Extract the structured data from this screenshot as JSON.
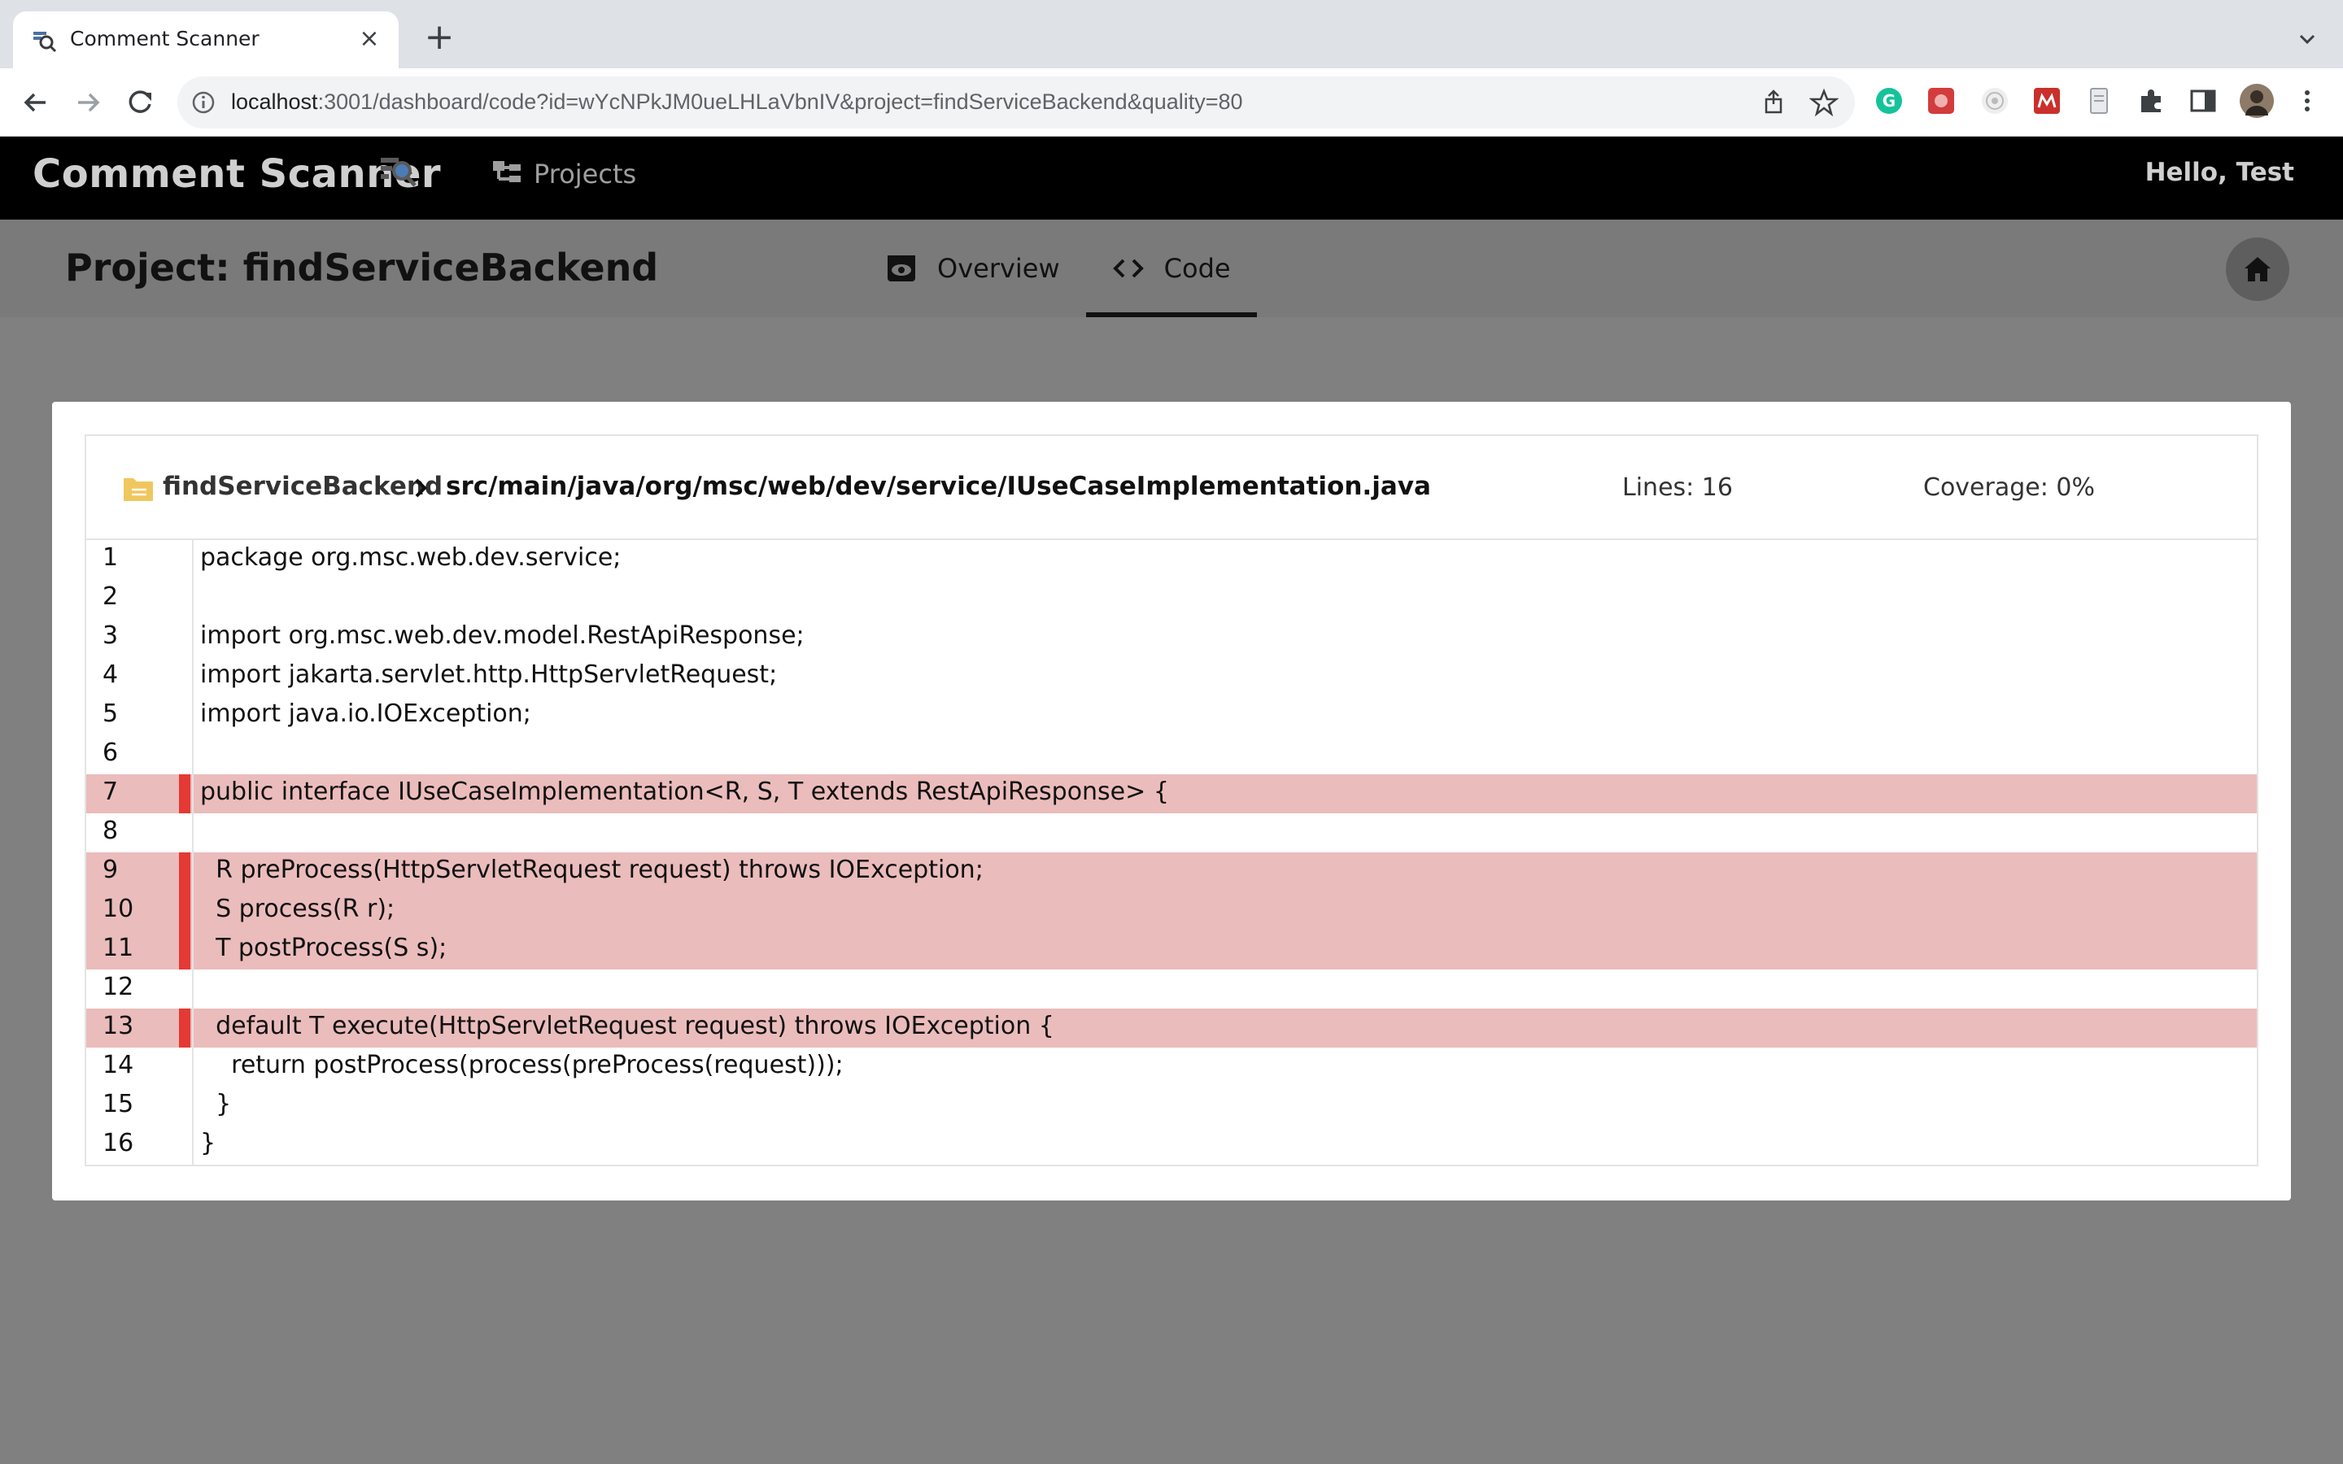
{
  "browser": {
    "tab_title": "Comment Scanner",
    "url_host": "localhost",
    "url_path": ":3001/dashboard/code?id=wYcNPkJM0ueLHLaVbnIV&project=findServiceBackend&quality=80"
  },
  "header": {
    "brand": "Comment Scanner",
    "nav_projects": "Projects",
    "greeting": "Hello, Test"
  },
  "project": {
    "title": "Project: findServiceBackend",
    "tabs": [
      {
        "label": "Overview",
        "icon": "eye-icon"
      },
      {
        "label": "Code",
        "icon": "code-icon"
      }
    ],
    "active_tab": "Code"
  },
  "file": {
    "project_name": "findServiceBackend",
    "path": "src/main/java/org/msc/web/dev/service/IUseCaseImplementation.java",
    "lines_label": "Lines: 16",
    "coverage_label": "Coverage: 0%"
  },
  "code_lines": [
    {
      "n": "1",
      "text": "package org.msc.web.dev.service;",
      "uncovered": false
    },
    {
      "n": "2",
      "text": "",
      "uncovered": false
    },
    {
      "n": "3",
      "text": "import org.msc.web.dev.model.RestApiResponse;",
      "uncovered": false
    },
    {
      "n": "4",
      "text": "import jakarta.servlet.http.HttpServletRequest;",
      "uncovered": false
    },
    {
      "n": "5",
      "text": "import java.io.IOException;",
      "uncovered": false
    },
    {
      "n": "6",
      "text": "",
      "uncovered": false
    },
    {
      "n": "7",
      "text": "public interface IUseCaseImplementation<R, S, T extends RestApiResponse> {",
      "uncovered": true
    },
    {
      "n": "8",
      "text": "",
      "uncovered": false
    },
    {
      "n": "9",
      "text": "  R preProcess(HttpServletRequest request) throws IOException;",
      "uncovered": true
    },
    {
      "n": "10",
      "text": "  S process(R r);",
      "uncovered": true
    },
    {
      "n": "11",
      "text": "  T postProcess(S s);",
      "uncovered": true
    },
    {
      "n": "12",
      "text": "",
      "uncovered": false
    },
    {
      "n": "13",
      "text": "  default T execute(HttpServletRequest request) throws IOException {",
      "uncovered": true
    },
    {
      "n": "14",
      "text": "    return postProcess(process(preProcess(request)));",
      "uncovered": false
    },
    {
      "n": "15",
      "text": "  }",
      "uncovered": false
    },
    {
      "n": "16",
      "text": "}",
      "uncovered": false
    }
  ],
  "colors": {
    "uncovered_row": "#ebbcbc",
    "uncovered_marker": "#e53935",
    "header_bg": "#000000",
    "page_overlay": "#808080"
  }
}
